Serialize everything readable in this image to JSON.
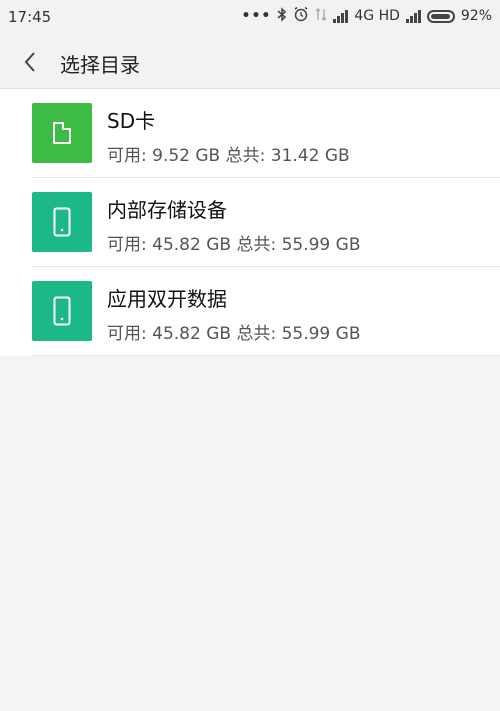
{
  "status_bar": {
    "time": "17:45",
    "network": "4G HD",
    "battery": "92%",
    "battery_level": 0.92
  },
  "header": {
    "title": "选择目录"
  },
  "colors": {
    "sd_tile": "#3dbb45",
    "device_tile": "#1cb887"
  },
  "storage_items": [
    {
      "icon": "sd-card-icon",
      "name": "SD卡",
      "detail": "可用: 9.52 GB 总共: 31.42 GB"
    },
    {
      "icon": "phone-icon",
      "name": "内部存储设备",
      "detail": "可用: 45.82 GB 总共: 55.99 GB"
    },
    {
      "icon": "phone-icon",
      "name": "应用双开数据",
      "detail": "可用: 45.82 GB 总共: 55.99 GB"
    }
  ]
}
